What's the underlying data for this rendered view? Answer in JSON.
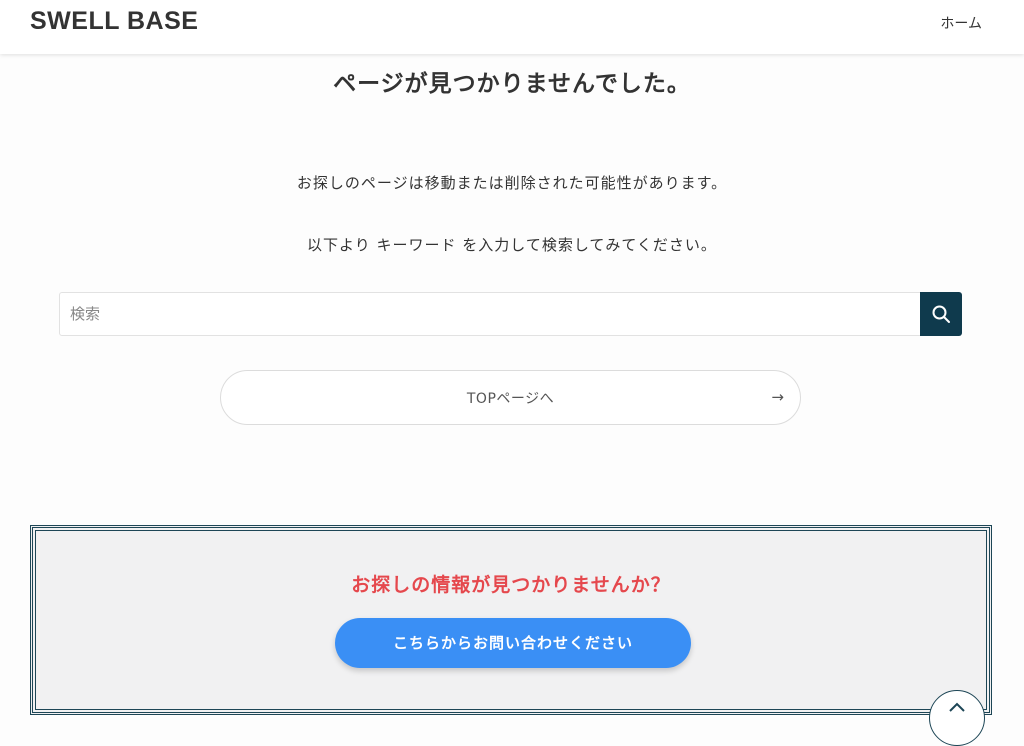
{
  "header": {
    "logo": "SWELL BASE",
    "nav": {
      "home_label": "ホーム"
    }
  },
  "main": {
    "title": "ページが見つかりませんでした。",
    "message_line1": "お探しのページは移動または削除された可能性があります。",
    "message_line2": "以下より キーワード を入力して検索してみてください。",
    "search": {
      "placeholder": "検索",
      "value": "",
      "button_icon": "search-icon"
    },
    "top_button": {
      "label": "TOPページへ",
      "arrow": "→"
    }
  },
  "cta": {
    "heading": "お探しの情報が見つかりませんか？",
    "button_label": "こちらからお問い合わせください",
    "heading_color": "#e5484d",
    "button_color": "#3a8ff5",
    "border_color": "#1d4656"
  },
  "back_to_top": {
    "icon": "chevron-up-icon"
  },
  "colors": {
    "accent": "#0f3a4d"
  }
}
